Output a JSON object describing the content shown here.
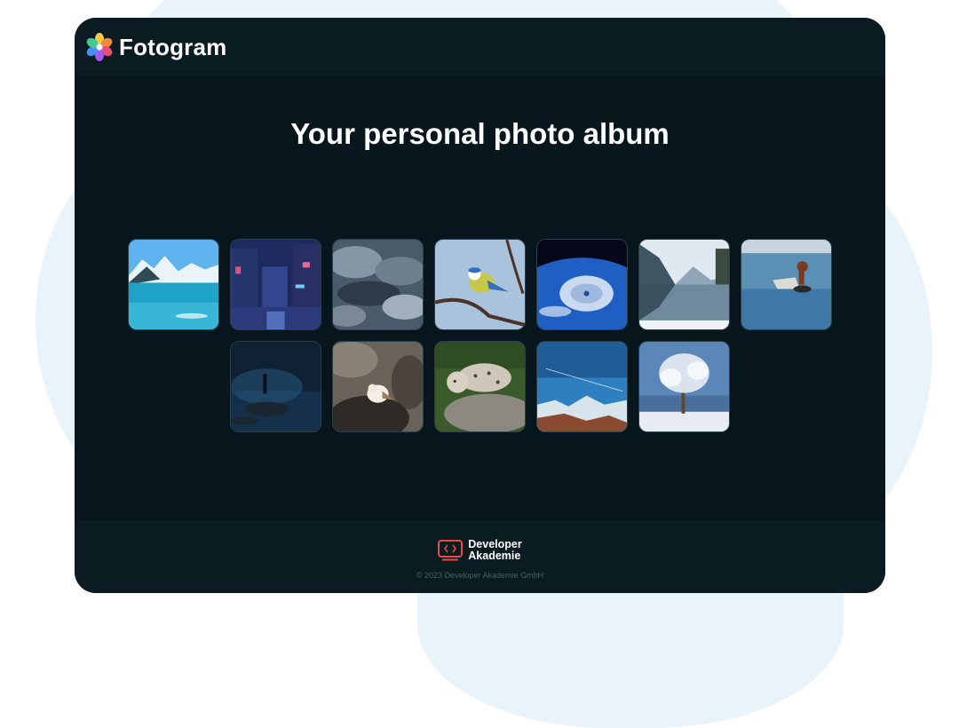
{
  "header": {
    "brand": "Fotogram",
    "logo_icon": "flower-icon"
  },
  "main": {
    "title": "Your personal photo album",
    "photos": [
      {
        "name": "photo-glacier-lake"
      },
      {
        "name": "photo-neon-city-street"
      },
      {
        "name": "photo-storm-clouds"
      },
      {
        "name": "photo-blue-tit-bird"
      },
      {
        "name": "photo-hurricane-from-space"
      },
      {
        "name": "photo-winter-mountain-lake"
      },
      {
        "name": "photo-duck-in-water"
      },
      {
        "name": "photo-person-on-rock-at-night"
      },
      {
        "name": "photo-snow-bunting-bird"
      },
      {
        "name": "photo-snow-leopard"
      },
      {
        "name": "photo-mountains-under-blue-sky"
      },
      {
        "name": "photo-frosted-tree"
      }
    ]
  },
  "footer": {
    "logo_line1": "Developer",
    "logo_line2": "Akademie",
    "logo_icon": "code-screen-icon",
    "copyright": "© 2023 Developer Akademie GmbH"
  },
  "colors": {
    "background": "#07161c",
    "header": "#0a1c22",
    "accent_logo": "#e94b3c"
  }
}
